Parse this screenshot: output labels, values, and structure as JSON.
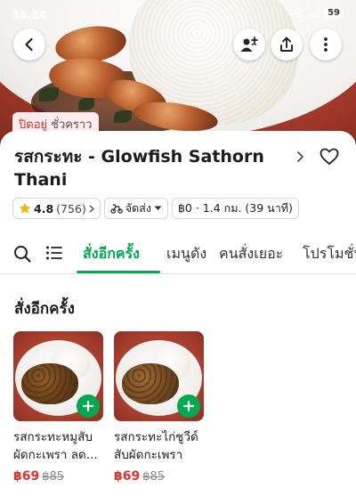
{
  "status_bar": {
    "time": "14:24",
    "battery": "59"
  },
  "store": {
    "closed_label": "ปิดอยู่",
    "closed_reason": "ชั่วคราว",
    "name": "รสกระทะ - Glowfish Sathorn Thani",
    "rating": "4.8",
    "review_count": "(756)",
    "delivery_mode": "จัดส่ง",
    "delivery_info": "฿0 · 1.4 กม. (39 นาที)"
  },
  "tabs": [
    {
      "label": "สั่งอีกครั้ง"
    },
    {
      "label": "เมนูดัง"
    },
    {
      "label": "คนสั่งเยอะ"
    },
    {
      "label": "โปรโมชั่น"
    }
  ],
  "section": {
    "title": "สั่งอีกครั้ง"
  },
  "items": [
    {
      "name": "รสกระทะหมูสับผัดกะเพรา ลด...",
      "price": "฿69",
      "old_price": "฿85"
    },
    {
      "name": "รสกระทะไก่ชูวีด์สับผัดกะเพรา ล...",
      "price": "฿69",
      "old_price": "฿85"
    }
  ],
  "colors": {
    "accent": "#00a94f",
    "price": "#e0302c",
    "closed_text": "#c0392b",
    "hero_bg": "#a63a2b"
  },
  "icons": [
    "back-arrow-icon",
    "add-friend-icon",
    "share-icon",
    "more-vertical-icon",
    "star-icon",
    "chevron-right-icon",
    "heart-icon",
    "search-icon",
    "list-icon",
    "chevron-down-icon",
    "delivery-icon",
    "plus-icon",
    "wifi-icon",
    "signal-icon"
  ]
}
